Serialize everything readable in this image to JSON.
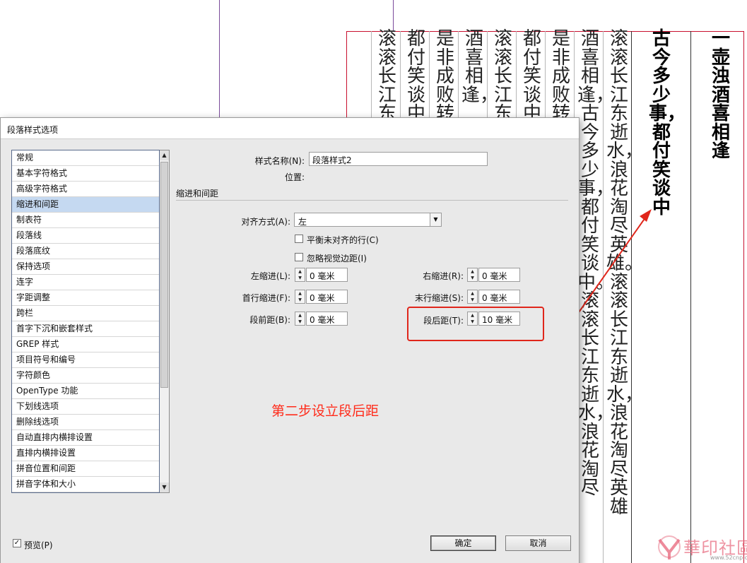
{
  "document": {
    "columns": [
      {
        "text": "一壶浊酒喜相逢",
        "bold": true
      },
      {
        "text": "古今多少事，都付笑谈中",
        "bold": true
      },
      {
        "text": "滚滚长江东逝水，浪花淘尽英雄。滚滚长江东逝水，浪花淘尽英雄",
        "bold": false
      },
      {
        "text": "酒喜相逢，古今多少事，都付笑谈中。滚滚长江东逝水，浪花淘尽",
        "bold": false
      },
      {
        "text": "是非成败转",
        "bold": false
      },
      {
        "text": "都付笑谈中",
        "bold": false
      },
      {
        "text": "滚滚长江东",
        "bold": false
      },
      {
        "text": "酒喜相逢，",
        "bold": false
      },
      {
        "text": "是非成败转",
        "bold": false
      },
      {
        "text": "都付笑谈中",
        "bold": false
      },
      {
        "text": "滚滚长江东",
        "bold": false
      }
    ]
  },
  "dialog": {
    "title": "段落样式选项",
    "categories": [
      "常规",
      "基本字符格式",
      "高级字符格式",
      "缩进和间距",
      "制表符",
      "段落线",
      "段落底纹",
      "保持选项",
      "连字",
      "字距调整",
      "跨栏",
      "首字下沉和嵌套样式",
      "GREP 样式",
      "项目符号和编号",
      "字符颜色",
      "OpenType 功能",
      "下划线选项",
      "删除线选项",
      "自动直排内横排设置",
      "直排内横排设置",
      "拼音位置和间距",
      "拼音字体和大小"
    ],
    "selected_category": "缩进和间距",
    "style_name_label": "样式名称(N):",
    "style_name_value": "段落样式2",
    "location_label": "位置:",
    "section_title": "缩进和间距",
    "alignment_label": "对齐方式(A):",
    "alignment_value": "左",
    "balance_label": "平衡未对齐的行(C)",
    "balance_checked": false,
    "ignore_margin_label": "忽略视觉边距(I)",
    "ignore_margin_checked": false,
    "left_indent_label": "左缩进(L):",
    "left_indent_value": "0 毫米",
    "right_indent_label": "右缩进(R):",
    "right_indent_value": "0 毫米",
    "first_indent_label": "首行缩进(F):",
    "first_indent_value": "0 毫米",
    "last_indent_label": "末行缩进(S):",
    "last_indent_value": "0 毫米",
    "space_before_label": "段前距(B):",
    "space_before_value": "0 毫米",
    "space_after_label": "段后距(T):",
    "space_after_value": "10 毫米",
    "preview_label": "预览(P)",
    "preview_checked": true,
    "ok_label": "确定",
    "cancel_label": "取消"
  },
  "annotation": {
    "text": "第二步设立段后距",
    "color": "#ff2b1a"
  },
  "watermark": {
    "text": "華印社區",
    "url": "www.52cnp.com"
  },
  "icons": {
    "checkbox_checked": "check-icon",
    "dropdown": "chevron-down-icon",
    "spinner": "spinner-arrows-icon"
  }
}
